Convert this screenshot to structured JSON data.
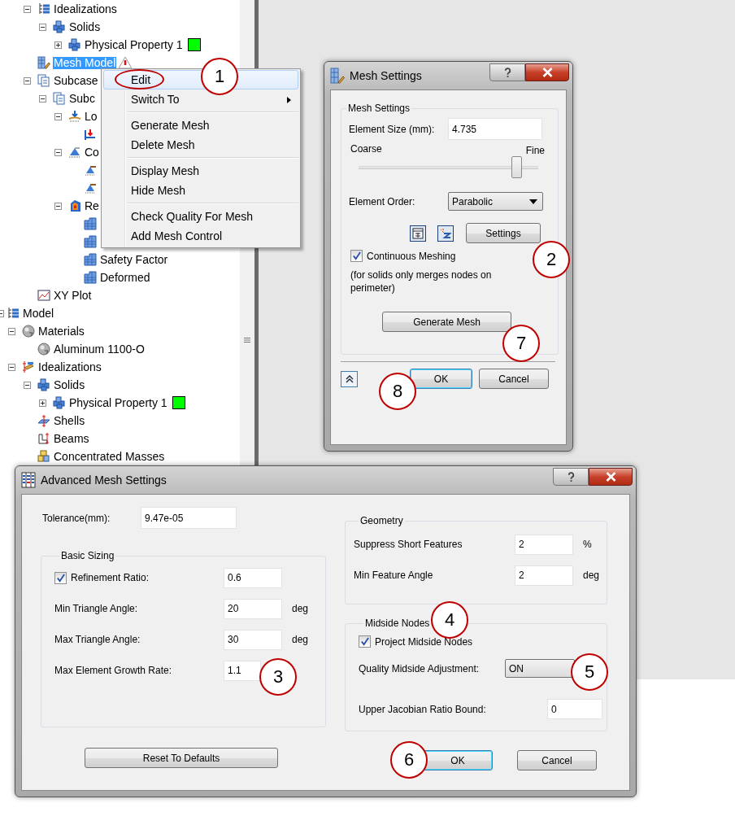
{
  "tree": [
    {
      "label": "Idealizations",
      "kind": "hierarchy",
      "expanded": true,
      "selected": false,
      "children": [
        {
          "label": "Solids",
          "kind": "solids",
          "expanded": true,
          "selected": false,
          "children": [
            {
              "label": "Physical Property 1",
              "kind": "solids",
              "expanded": false,
              "selected": false,
              "color": "#00ff00"
            }
          ]
        }
      ]
    },
    {
      "label": "Mesh Model",
      "kind": "mesh",
      "selected": true,
      "warning": true
    },
    {
      "label": "Subcase",
      "kind": "subcase",
      "expanded": true,
      "selected": false,
      "children": [
        {
          "label": "Subc",
          "kind": "subcase",
          "expanded": true,
          "selected": false,
          "children": [
            {
              "label": "Lo",
              "kind": "loads",
              "expanded": true,
              "selected": false,
              "children": [
                {
                  "kind": "force",
                  "selected": false
                }
              ]
            },
            {
              "label": "Co",
              "kind": "constraints",
              "expanded": true,
              "selected": false,
              "children": [
                {
                  "kind": "constraint",
                  "selected": false
                },
                {
                  "kind": "constraint",
                  "selected": false
                }
              ]
            },
            {
              "label": "Re",
              "kind": "results",
              "expanded": true,
              "selected": false,
              "children": [
                {
                  "kind": "result",
                  "selected": false
                },
                {
                  "kind": "result",
                  "selected": false
                },
                {
                  "label": "Safety Factor",
                  "kind": "result",
                  "selected": false
                },
                {
                  "label": "Deformed",
                  "kind": "result",
                  "selected": false
                }
              ]
            }
          ]
        }
      ]
    },
    {
      "label": "XY Plot",
      "kind": "plot",
      "selected": false
    }
  ],
  "tree_lower": [
    {
      "label": "Model",
      "kind": "hierarchy",
      "expanded": true,
      "selected": false,
      "children": [
        {
          "label": "Materials",
          "kind": "material",
          "expanded": true,
          "selected": false,
          "children": [
            {
              "label": "Aluminum 1100-O",
              "kind": "material",
              "selected": false
            }
          ]
        },
        {
          "label": "Idealizations",
          "kind": "idealization",
          "expanded": true,
          "selected": false,
          "children": [
            {
              "label": "Solids",
              "kind": "solids",
              "expanded": true,
              "selected": false,
              "children": [
                {
                  "label": "Physical Property 1",
                  "kind": "solids",
                  "expanded": false,
                  "selected": false,
                  "color": "#00ff00"
                }
              ]
            },
            {
              "label": "Shells",
              "kind": "shells",
              "selected": false
            },
            {
              "label": "Beams",
              "kind": "beams",
              "selected": false
            },
            {
              "label": "Concentrated Masses",
              "kind": "masses",
              "selected": false
            }
          ]
        }
      ]
    }
  ],
  "context_menu": {
    "groups": [
      [
        {
          "label": "Edit",
          "selected": true
        },
        {
          "label": "Switch To",
          "selected": false,
          "submenu": true
        }
      ],
      [
        {
          "label": "Generate Mesh",
          "selected": false
        },
        {
          "label": "Delete Mesh",
          "selected": false
        }
      ],
      [
        {
          "label": "Display Mesh",
          "selected": false
        },
        {
          "label": "Hide Mesh",
          "selected": false
        }
      ],
      [
        {
          "label": "Check Quality For Mesh",
          "selected": false
        },
        {
          "label": "Add Mesh Control",
          "selected": false
        }
      ]
    ]
  },
  "mesh_settings": {
    "title": "Mesh Settings",
    "group_title": "Mesh Settings",
    "element_size_label": "Element Size (mm):",
    "element_size": "4.735",
    "coarse_label": "Coarse",
    "fine_label": "Fine",
    "slider": {
      "level": 0.88
    },
    "element_order_label": "Element Order:",
    "element_order": "Parabolic",
    "settings_button": "Settings",
    "continuous_meshing": {
      "label": "Continuous Meshing",
      "checked": true
    },
    "note": "(for solids only merges nodes on perimeter)",
    "generate_button": "Generate Mesh",
    "ok_button": "OK",
    "cancel_button": "Cancel"
  },
  "advanced_mesh_settings": {
    "title": "Advanced Mesh Settings",
    "tolerance_label": "Tolerance(mm):",
    "tolerance": "9.47e-05",
    "basic_sizing": {
      "title": "Basic Sizing",
      "rows": [
        {
          "kind": "checkbox",
          "label": "Refinement Ratio:",
          "checked": true,
          "value": "0.6"
        },
        {
          "kind": "field",
          "label": "Min Triangle Angle:",
          "value": "20",
          "unit": "deg"
        },
        {
          "kind": "field",
          "label": "Max Triangle Angle:",
          "value": "30",
          "unit": "deg"
        },
        {
          "kind": "field",
          "label": "Max Element Growth Rate:",
          "value": "1.1"
        }
      ]
    },
    "reset_button": "Reset To Defaults",
    "geometry": {
      "title": "Geometry",
      "rows": [
        {
          "label": "Suppress Short Features",
          "value": "2",
          "unit": "%"
        },
        {
          "label": "Min Feature Angle",
          "value": "2",
          "unit": "deg"
        }
      ]
    },
    "midside_nodes": {
      "title": "Midside Nodes",
      "project": {
        "label": "Project Midside Nodes",
        "checked": true
      },
      "adjustment_label": "Quality Midside Adjustment:",
      "adjustment": "ON",
      "jacobian_label": "Upper Jacobian Ratio Bound:",
      "jacobian": "0"
    },
    "ok_button": "OK",
    "cancel_button": "Cancel"
  },
  "callouts": [
    {
      "label": "1"
    },
    {
      "label": "2"
    },
    {
      "label": "7"
    },
    {
      "label": "8"
    },
    {
      "label": "3"
    },
    {
      "label": "4"
    },
    {
      "label": "5"
    },
    {
      "label": "6"
    }
  ]
}
